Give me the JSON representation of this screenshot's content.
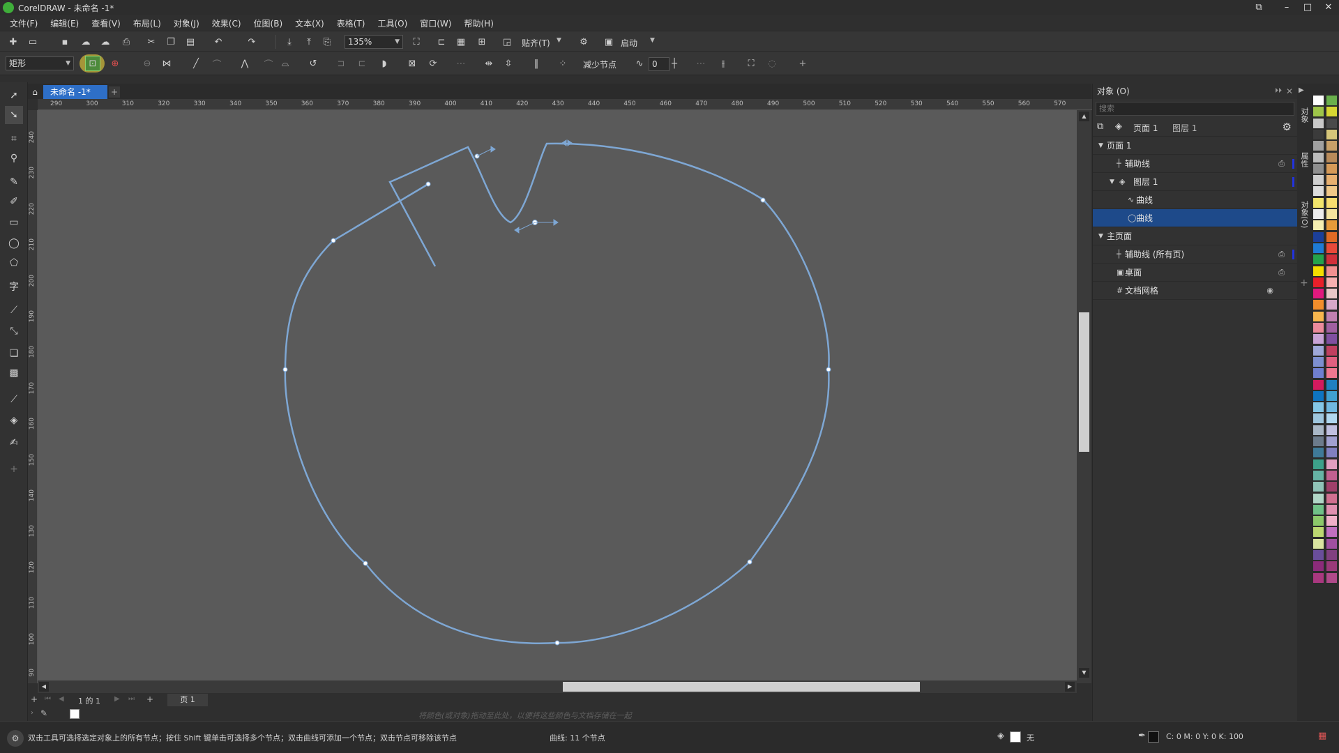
{
  "app": {
    "title": "CorelDRAW - 未命名 -1*"
  },
  "menu": [
    "文件(F)",
    "编辑(E)",
    "查看(V)",
    "布局(L)",
    "对象(J)",
    "效果(C)",
    "位图(B)",
    "文本(X)",
    "表格(T)",
    "工具(O)",
    "窗口(W)",
    "帮助(H)"
  ],
  "toolbar1": {
    "zoom_value": "135%",
    "snap_label": "贴齐(T)",
    "launch_label": "启动"
  },
  "toolbar2": {
    "selection_mode": "矩形",
    "reduce_nodes_label": "减少节点",
    "smoothness_value": "0"
  },
  "document": {
    "tab_label": "未命名 -1*"
  },
  "ruler": {
    "h_ticks": [
      "290",
      "300",
      "310",
      "320",
      "330",
      "340",
      "350",
      "360",
      "370",
      "380",
      "390",
      "400",
      "410",
      "420",
      "430",
      "440",
      "450",
      "460",
      "470",
      "480",
      "490",
      "500",
      "510",
      "520",
      "530",
      "540",
      "550",
      "560",
      "570"
    ],
    "v_ticks": [
      "240",
      "230",
      "220",
      "210",
      "200",
      "190",
      "180",
      "170",
      "160",
      "150",
      "140",
      "130",
      "120",
      "110",
      "100",
      "90"
    ]
  },
  "pagebar": {
    "page_count": "1 的 1",
    "page_tab": "页 1"
  },
  "colorbar": {
    "hint": "将颜色(或对象)拖动至此处，以便将这些颜色与文档存储在一起"
  },
  "status": {
    "hint": "双击工具可选择选定对象上的所有节点；按住 Shift 键单击可选择多个节点；双击曲线可添加一个节点；双击节点可移除该节点",
    "object_info": "曲线:  11 个节点",
    "fill_label": "无",
    "cmyk": "C: 0 M: 0 Y: 0 K: 100"
  },
  "docker": {
    "title": "对象 (O)",
    "search_placeholder": "搜索",
    "current_page": "页面 1",
    "current_layer": "图层 1",
    "tree": [
      {
        "label": "页面 1",
        "level": 0,
        "arrow": "▼",
        "icon": ""
      },
      {
        "label": "辅助线",
        "level": 1,
        "arrow": "",
        "icon": "┼"
      },
      {
        "label": "图层 1",
        "level": 1,
        "arrow": "▼",
        "icon": "◈"
      },
      {
        "label": "曲线",
        "level": 2,
        "arrow": "",
        "icon": "∿"
      },
      {
        "label": "曲线",
        "level": 2,
        "arrow": "",
        "icon": "◯"
      },
      {
        "label": "主页面",
        "level": 0,
        "arrow": "▼",
        "icon": ""
      },
      {
        "label": "辅助线 (所有页)",
        "level": 1,
        "arrow": "",
        "icon": "┼"
      },
      {
        "label": "桌面",
        "level": 1,
        "arrow": "",
        "icon": "▣"
      },
      {
        "label": "文档网格",
        "level": 1,
        "arrow": "",
        "icon": "#"
      }
    ],
    "selected_index": 4
  },
  "side_tabs": [
    "对象",
    "属性",
    "对象(O)"
  ],
  "colors": {
    "accent": "#2e6fc7",
    "curve": "#7ea7d4",
    "canvas": "#5a5a5a",
    "selection": "#1e4a8a"
  }
}
